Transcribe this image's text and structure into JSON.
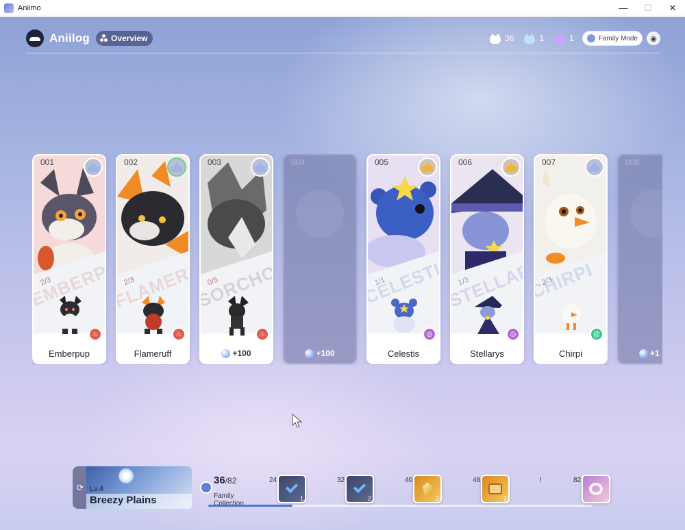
{
  "window": {
    "title": "Aniimo",
    "minimize": "—",
    "maximize": "☐",
    "close": "✕"
  },
  "header": {
    "brand": "Aniilog",
    "overview_label": "Overview",
    "stats": [
      {
        "icon": "cat-white-icon",
        "value": "36"
      },
      {
        "icon": "cat-blue-icon",
        "value": "1"
      },
      {
        "icon": "cat-purple-icon",
        "value": "1"
      }
    ],
    "family_mode_label": "Family Mode"
  },
  "cards": [
    {
      "number": "001",
      "name": "Emberpup",
      "bg_name": "EMBERPUP",
      "progress": "2/3",
      "element": "fire",
      "badge": "silver",
      "locked": false
    },
    {
      "number": "002",
      "name": "Flameruff",
      "bg_name": "FLAMERUFF",
      "progress": "2/3",
      "element": "fire",
      "badge": "silver-green",
      "locked": false
    },
    {
      "number": "003",
      "name": "",
      "bg_name": "SORCHOWL",
      "progress": "0/5",
      "element": "fire",
      "badge": "silver",
      "reward": "+100",
      "locked": false
    },
    {
      "number": "004",
      "name": "",
      "reward": "+100",
      "locked": true
    },
    {
      "number": "005",
      "name": "Celestis",
      "bg_name": "CELESTIS",
      "progress": "1/1",
      "element": "mystic",
      "badge": "gold",
      "locked": false
    },
    {
      "number": "006",
      "name": "Stellarys",
      "bg_name": "STELLARYS",
      "progress": "1/3",
      "element": "mystic",
      "badge": "gold",
      "locked": false
    },
    {
      "number": "007",
      "name": "Chirpi",
      "bg_name": "CHIRPI",
      "progress": "2/3",
      "element": "wind",
      "badge": "silver",
      "locked": false
    },
    {
      "number": "008",
      "name": "",
      "reward": "+1",
      "locked": true
    }
  ],
  "region": {
    "level": "Lv.4",
    "name": "Breezy Plains"
  },
  "collection": {
    "current": "36",
    "total": "/82",
    "label_line1": "Family",
    "label_line2": "Collection"
  },
  "milestones": [
    {
      "threshold": "24",
      "quantity": "1",
      "type": "check",
      "style": "dark"
    },
    {
      "threshold": "32",
      "quantity": "2",
      "type": "check",
      "style": "dark"
    },
    {
      "threshold": "40",
      "quantity": "2",
      "type": "crystal",
      "style": "gold"
    },
    {
      "threshold": "48",
      "quantity": "2",
      "type": "chest",
      "style": "gold"
    },
    {
      "threshold": "82",
      "quantity": "",
      "type": "ring",
      "style": "final"
    }
  ],
  "milestone_extra_label": "!",
  "progress_fraction": 0.22,
  "colors": {
    "accent": "#4f74d6",
    "fire": "#e25b52",
    "mystic": "#b565d6",
    "wind": "#3bc58a"
  }
}
